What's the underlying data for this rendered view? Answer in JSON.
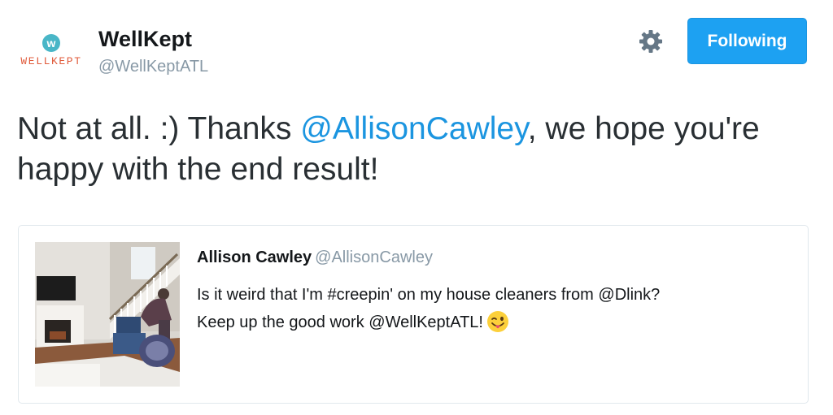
{
  "author": {
    "avatar_letter": "w",
    "avatar_wordmark": "WELLKEPT",
    "display_name": "WellKept",
    "handle": "@WellKeptATL"
  },
  "actions": {
    "settings_icon": "gear-icon",
    "follow_label": "Following"
  },
  "tweet": {
    "text_before": "Not at all. :)  Thanks ",
    "mention": "@AllisonCawley",
    "text_after": ", we hope you're happy with the end result!"
  },
  "quoted_tweet": {
    "display_name": "Allison Cawley",
    "handle": "@AllisonCawley",
    "line1": "Is it weird that I'm #creepin' on my house cleaners from @Dlink?",
    "line2": "Keep up the good work @WellKeptATL!",
    "emoji": "winking-face-with-tongue-emoji",
    "image": "living-room-thumbnail"
  },
  "colors": {
    "accent": "#1da1f2",
    "link": "#1b95e0",
    "brand_teal": "#49b6c7",
    "brand_orange": "#e05a3a",
    "muted": "#8899a6"
  }
}
